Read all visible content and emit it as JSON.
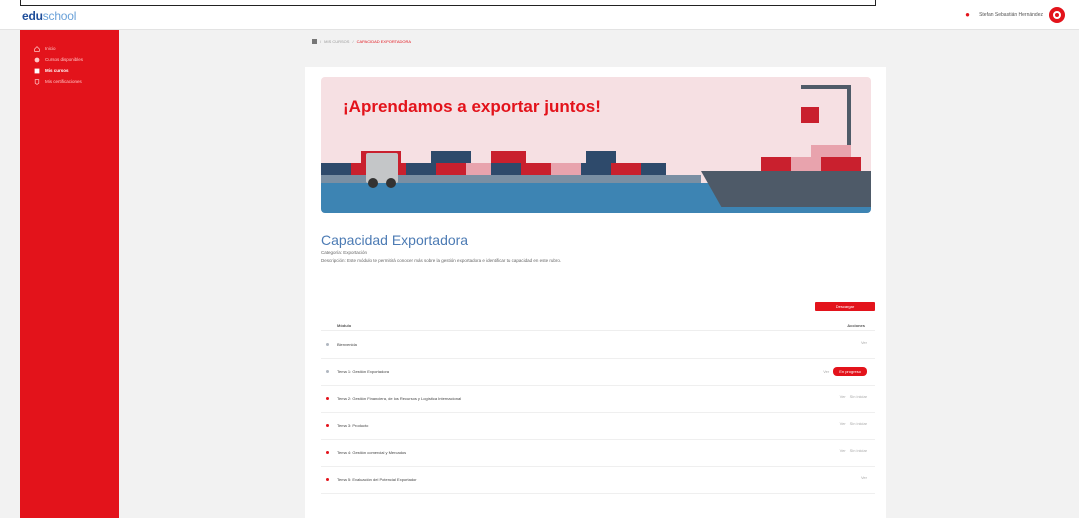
{
  "header": {
    "logo_part_a": "edu",
    "logo_part_b": "school",
    "user_name": "Stefan Sebastián Hernández"
  },
  "sidebar": {
    "items": [
      {
        "label": "Inicio",
        "icon": "home-icon",
        "active": false
      },
      {
        "label": "Cursos disponibles",
        "icon": "grid-icon",
        "active": false
      },
      {
        "label": "Mis cursos",
        "icon": "book-icon",
        "active": true
      },
      {
        "label": "Mis certificaciones",
        "icon": "certificate-icon",
        "active": false
      }
    ]
  },
  "breadcrumb": {
    "section": "MIS CURSOS",
    "current": "CAPACIDAD EXPORTADORA"
  },
  "banner": {
    "title": "¡Aprendamos a exportar juntos!"
  },
  "course": {
    "title": "Capacidad Exportadora",
    "category": "Categoría: Exportación",
    "description": "Descripción: Este módulo te permitirá conocer más sobre la gestión exportadora e identificar tu capacidad en este rubro."
  },
  "action_button": {
    "label": "Descargar"
  },
  "table": {
    "col_module": "Módulo",
    "col_actions": "Acciones",
    "rows": [
      {
        "label": "Bienvenida",
        "dot": "grey",
        "ver": "Ver",
        "status": ""
      },
      {
        "label": "Tema 1: Gestión Exportadora",
        "dot": "grey",
        "ver": "Ver",
        "status": "En progreso",
        "badge": true
      },
      {
        "label": "Tema 2: Gestión Financiera, de los Recursos y Logística Internacional",
        "dot": "red",
        "ver": "Ver",
        "status": "Sin iniciar"
      },
      {
        "label": "Tema 3: Producto",
        "dot": "red",
        "ver": "Ver",
        "status": "Sin iniciar"
      },
      {
        "label": "Tema 4: Gestión comercial y Mercados",
        "dot": "red",
        "ver": "Ver",
        "status": "Sin iniciar"
      },
      {
        "label": "Tema 5: Evaluación del Potencial Exportador",
        "dot": "red",
        "ver": "Ver",
        "status": ""
      }
    ]
  },
  "colors": {
    "primary_red": "#e3131b",
    "title_blue": "#4c7bb4"
  }
}
